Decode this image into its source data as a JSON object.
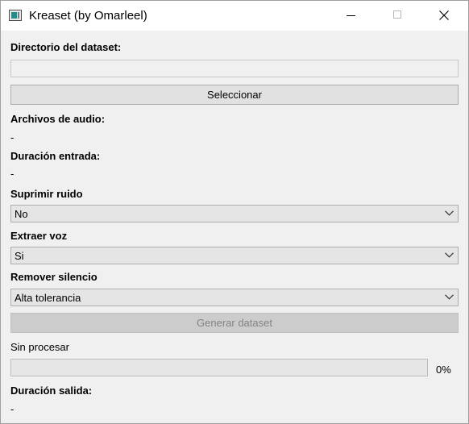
{
  "window": {
    "title": "Kreaset (by Omarleel)",
    "icon": "app-window-icon"
  },
  "dataset_dir": {
    "label": "Directorio del dataset:",
    "value": "",
    "select_button": "Seleccionar"
  },
  "audio_files": {
    "label": "Archivos de audio:",
    "value": "-"
  },
  "input_duration": {
    "label": "Duración entrada:",
    "value": "-"
  },
  "noise": {
    "label": "Suprimir ruido",
    "selected": "No"
  },
  "voice": {
    "label": "Extraer voz",
    "selected": "Si"
  },
  "silence": {
    "label": "Remover silencio",
    "selected": "Alta tolerancia"
  },
  "generate_button": "Generar dataset",
  "status": "Sin procesar",
  "progress": {
    "value": 0,
    "text": "0%"
  },
  "output_duration": {
    "label": "Duración salida:",
    "value": "-"
  }
}
